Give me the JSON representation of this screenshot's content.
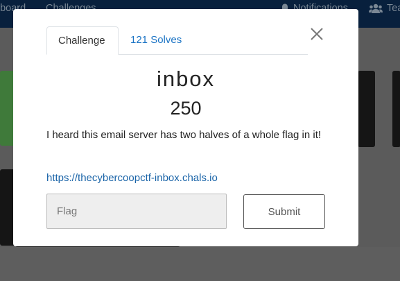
{
  "navbar": {
    "left_links": [
      "eboard",
      "Challenges"
    ],
    "notifications_label": "Notifications",
    "team_label": "Tea",
    "icons": {
      "notifications": "bell-icon",
      "team": "users-icon"
    }
  },
  "modal": {
    "tabs": [
      {
        "label": "Challenge",
        "active": true
      },
      {
        "label": "121 Solves",
        "active": false
      }
    ],
    "close_icon": "close-icon",
    "challenge": {
      "name": "inbox",
      "value": "250",
      "description": "I heard this email server has two halves of a whole flag in it!",
      "link": "https://thecybercoopctf-inbox.chals.io"
    },
    "flag_input": {
      "value": "",
      "placeholder": "Flag"
    },
    "submit_label": "Submit"
  },
  "colors": {
    "navbar": "#08203d",
    "overlay": "#5b5b5b",
    "link": "#1a64a8",
    "tab_link": "#1a73c4",
    "solved_card": "#3f7a3a"
  }
}
